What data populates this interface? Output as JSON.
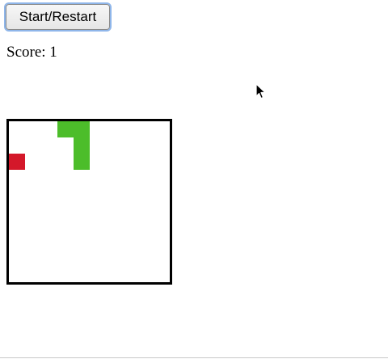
{
  "controls": {
    "start_label": "Start/Restart"
  },
  "score": {
    "label": "Score:",
    "value": 1
  },
  "board": {
    "grid_size": 10,
    "snake_color": "#4cbd2a",
    "food_color": "#d4182a",
    "border_color": "#000000",
    "snake_cells": [
      [
        3,
        0
      ],
      [
        4,
        0
      ],
      [
        4,
        1
      ],
      [
        4,
        2
      ]
    ],
    "food_cell": [
      0,
      2
    ]
  },
  "icons": {
    "cursor": "mouse-pointer-icon"
  }
}
